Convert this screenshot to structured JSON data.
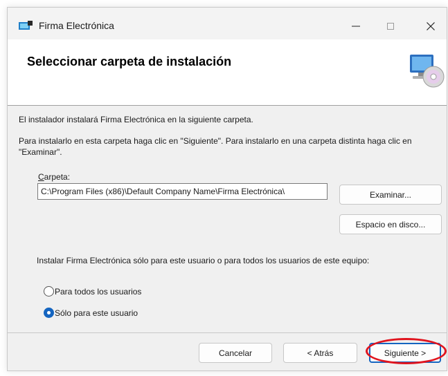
{
  "window": {
    "title": "Firma Electrónica",
    "controls": {
      "minimize": "—",
      "maximize": "☐",
      "close": "✕"
    }
  },
  "header": {
    "title": "Seleccionar carpeta de instalación",
    "icon": "computer-disc-icon"
  },
  "body": {
    "intro": "El instalador instalará Firma Electrónica en la siguiente carpeta.",
    "instructions": "Para instalarlo en esta carpeta haga clic en \"Siguiente\". Para instalarlo en una carpeta distinta haga clic en \"Examinar\".",
    "folder_label_access_key": "C",
    "folder_label_rest": "arpeta:",
    "folder_value": "C:\\Program Files (x86)\\Default Company Name\\Firma Electrónica\\",
    "browse_label": "Examinar...",
    "disk_space_label": "Espacio en disco...",
    "scope_question": "Instalar Firma Electrónica sólo para este usuario o para todos los usuarios de este equipo:",
    "options": [
      {
        "label": "Para todos los usuarios",
        "selected": false
      },
      {
        "label": "Sólo para este usuario",
        "selected": true
      }
    ]
  },
  "footer": {
    "cancel_label": "Cancelar",
    "back_label": "< Atrás",
    "next_label": "Siguiente >"
  },
  "colors": {
    "accent": "#1565c0",
    "annotation": "#e0141e"
  }
}
